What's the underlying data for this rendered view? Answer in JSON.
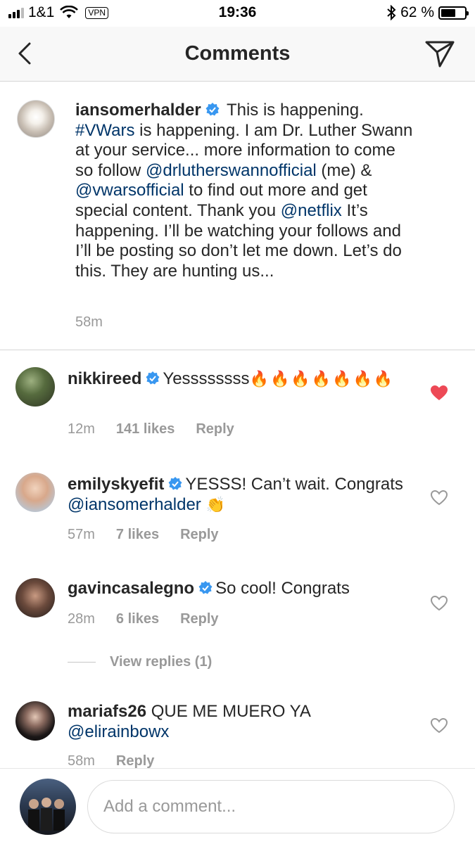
{
  "status_bar": {
    "carrier": "1&1",
    "vpn": "VPN",
    "time": "19:36",
    "battery": "62 %",
    "battery_level": 0.62
  },
  "nav": {
    "title": "Comments",
    "back_icon": "chevron-left-icon",
    "send_icon": "paper-plane-icon"
  },
  "caption": {
    "username": "iansomerhalder",
    "segments": [
      {
        "text": "This is happening. ",
        "link": false
      },
      {
        "text": "#VWars",
        "link": true
      },
      {
        "text": " is happening. I am Dr. Luther Swann at your service... more information to come so follow ",
        "link": false
      },
      {
        "text": "@drlutherswannofficial",
        "link": true
      },
      {
        "text": " (me) & ",
        "link": false
      },
      {
        "text": "@vwarsofficial",
        "link": true
      },
      {
        "text": " to find out more and get special content. Thank you ",
        "link": false
      },
      {
        "text": "@netflix",
        "link": true
      },
      {
        "text": " It’s happening. I’ll be watching your follows and I’ll be posting so don’t let me down. Let’s do this. They are hunting us...",
        "link": false
      }
    ],
    "time": "58m"
  },
  "comments": [
    {
      "username": "nikkireed",
      "verified": true,
      "text": "Yessssssss",
      "emoji": "🔥🔥🔥🔥🔥🔥🔥",
      "time": "12m",
      "likes": "141 likes",
      "reply": "Reply",
      "liked": true
    },
    {
      "username": "emilyskyefit",
      "verified": true,
      "text": "YESSS! Can’t wait. Congrats ",
      "mention": "@iansomerhalder",
      "emoji": "👏",
      "time": "57m",
      "likes": "7 likes",
      "reply": "Reply",
      "liked": false
    },
    {
      "username": "gavincasalegno",
      "verified": true,
      "text": "So cool! Congrats",
      "time": "28m",
      "likes": "6 likes",
      "reply": "Reply",
      "liked": false,
      "view_replies": "View replies (1)"
    },
    {
      "username": "mariafs26",
      "verified": false,
      "text": "QUE ME MUERO YA ",
      "mention": "@elirainbowx",
      "time": "58m",
      "reply": "Reply",
      "liked": false
    }
  ],
  "footer": {
    "placeholder": "Add a comment..."
  },
  "colors": {
    "link": "#003569",
    "verified": "#3897f0",
    "liked": "#ed4956",
    "muted": "#999999"
  }
}
